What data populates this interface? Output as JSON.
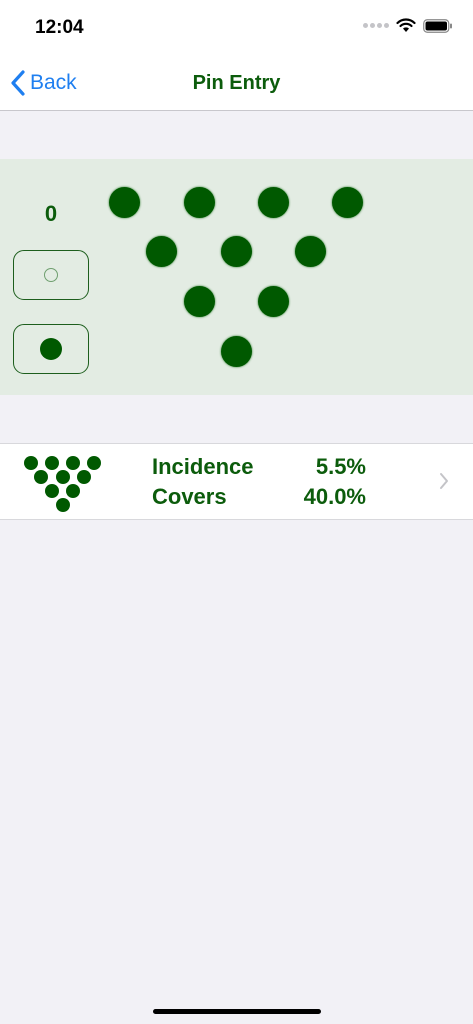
{
  "status_bar": {
    "time": "12:04",
    "icons": [
      "cellular-dots-icon",
      "wifi-icon",
      "battery-icon"
    ]
  },
  "nav": {
    "back_label": "Back",
    "title": "Pin Entry"
  },
  "pin_entry": {
    "frame_value": "0",
    "mode_buttons": [
      "empty-circle-icon",
      "filled-circle-icon"
    ],
    "pins_standing": 10
  },
  "result": {
    "incidence_label": "Incidence",
    "incidence_value": "5.5%",
    "covers_label": "Covers",
    "covers_value": "40.0%"
  },
  "colors": {
    "accent_green": "#005900",
    "text_green": "#0c5c0c",
    "panel_bg": "#e3ece3",
    "link_blue": "#1f7ff0",
    "page_bg": "#f2f1f6"
  }
}
